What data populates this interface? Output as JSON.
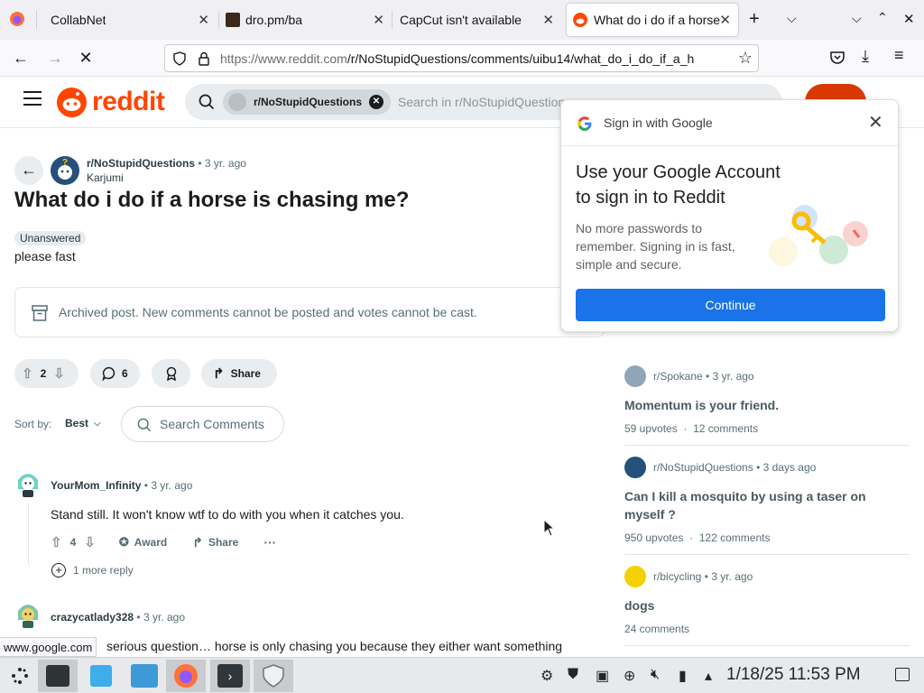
{
  "browser": {
    "tabs": [
      {
        "title": "CollabNet",
        "active": false
      },
      {
        "title": "dro.pm/ba",
        "active": false
      },
      {
        "title": "CapCut isn't available",
        "active": false
      },
      {
        "title": "What do i do if a horse",
        "active": true
      }
    ],
    "url_domain": "https://www.reddit.com",
    "url_path": "/r/NoStupidQuestions/comments/uibu14/what_do_i_do_if_a_h",
    "status_bar": "www.google.com"
  },
  "reddit": {
    "logo_text": "reddit",
    "search_chip": "r/NoStupidQuestions",
    "search_placeholder": "Search in r/NoStupidQuestions",
    "post": {
      "subreddit": "r/NoStupidQuestions",
      "age": "3 yr. ago",
      "author": "Karjumi",
      "title": "What do i do if a horse is chasing me?",
      "flair": "Unanswered",
      "body": "please fast",
      "archived_notice": "Archived post. New comments cannot be posted and votes cannot be cast.",
      "votes": "2",
      "comments": "6",
      "share_label": "Share"
    },
    "sort": {
      "label": "Sort by:",
      "value": "Best",
      "search_comments": "Search Comments"
    },
    "comments": [
      {
        "author": "YourMom_Infinity",
        "age": "3 yr. ago",
        "text": "Stand still. It won't know wtf to do with you when it catches you.",
        "votes": "4",
        "award_label": "Award",
        "share_label": "Share",
        "more_replies": "1 more reply"
      },
      {
        "author": "crazycatlady328",
        "age": "3 yr. ago",
        "text": "serious question… horse is only chasing you because they either want something"
      }
    ],
    "sidebar": [
      {
        "subreddit": "r/Spokane",
        "age": "3 yr. ago",
        "title": "Momentum is your friend.",
        "upvotes": "59 upvotes",
        "comments": "12 comments"
      },
      {
        "subreddit": "r/NoStupidQuestions",
        "age": "3 days ago",
        "title": "Can I kill a mosquito by using a taser on myself ?",
        "upvotes": "950 upvotes",
        "comments": "122 comments"
      },
      {
        "subreddit": "r/bicycling",
        "age": "3 yr. ago",
        "title": "dogs",
        "upvotes": "",
        "comments": "24 comments"
      }
    ]
  },
  "google_popup": {
    "header": "Sign in with Google",
    "heading_line1": "Use your Google Account",
    "heading_line2": "to sign in to Reddit",
    "body": "No more passwords to remember. Signing in is fast, simple and secure.",
    "button": "Continue"
  },
  "taskbar": {
    "clock": "1/18/25 11:53 PM"
  },
  "colors": {
    "reddit_orange": "#ff4500",
    "google_blue": "#1a73e8",
    "reddit_login": "#d93900"
  }
}
